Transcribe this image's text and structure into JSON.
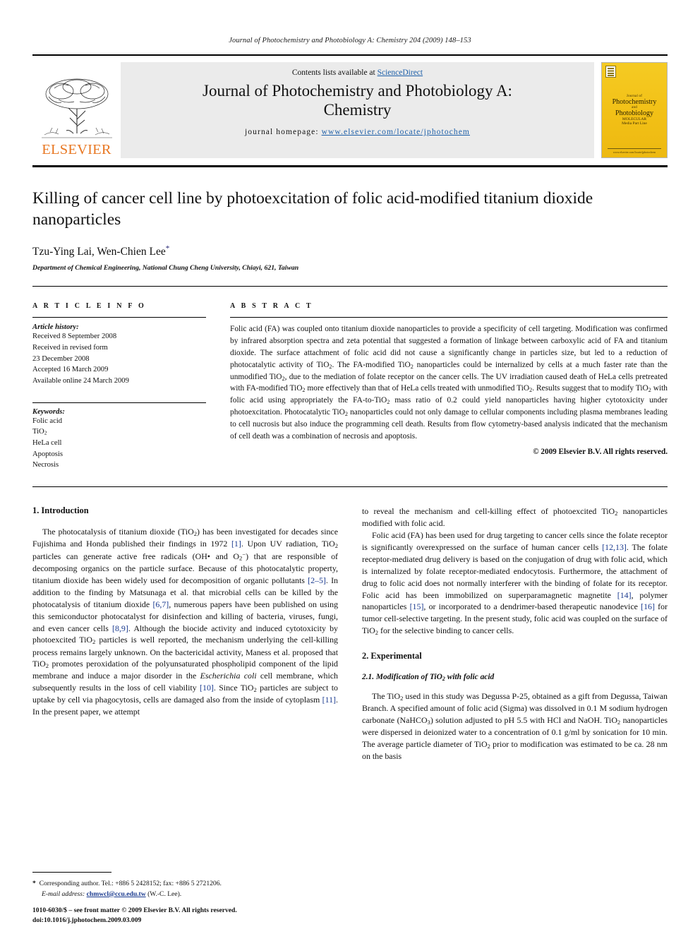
{
  "running_head": "Journal of Photochemistry and Photobiology A: Chemistry 204 (2009) 148–153",
  "masthead": {
    "publisher": "ELSEVIER",
    "contents_prefix": "Contents lists available at ",
    "contents_link": "ScienceDirect",
    "journal_title": "Journal of Photochemistry and Photobiology A: Chemistry",
    "homepage_prefix": "journal homepage: ",
    "homepage_url": "www.elsevier.com/locate/jphotochem",
    "cover": {
      "line_small": "Journal of",
      "line_big_1": "Photochemistry",
      "line_and": "and",
      "line_big_2": "Photobiology",
      "line_mid": "MOLECULAR",
      "line_foot": "Media Part Line",
      "bottom_note": "www.elsevier.com/locate/jphotochem"
    }
  },
  "title": "Killing of cancer cell line by photoexcitation of folic acid-modified titanium dioxide nanoparticles",
  "authors": "Tzu-Ying Lai, Wen-Chien Lee",
  "author_marker": "*",
  "affiliation": "Department of Chemical Engineering, National Chung Cheng University, Chiayi, 621, Taiwan",
  "article_info": {
    "heading": "A R T I C L E   I N F O",
    "history_label": "Article history:",
    "history": [
      "Received 8 September 2008",
      "Received in revised form",
      "23 December 2008",
      "Accepted 16 March 2009",
      "Available online 24 March 2009"
    ],
    "keywords_label": "Keywords:",
    "keywords": [
      "Folic acid",
      "TiO2",
      "HeLa cell",
      "Apoptosis",
      "Necrosis"
    ]
  },
  "abstract": {
    "heading": "A B S T R A C T",
    "text": "Folic acid (FA) was coupled onto titanium dioxide nanoparticles to provide a specificity of cell targeting. Modification was confirmed by infrared absorption spectra and zeta potential that suggested a formation of linkage between carboxylic acid of FA and titanium dioxide. The surface attachment of folic acid did not cause a significantly change in particles size, but led to a reduction of photocatalytic activity of TiO2. The FA-modified TiO2 nanoparticles could be internalized by cells at a much faster rate than the unmodified TiO2, due to the mediation of folate receptor on the cancer cells. The UV irradiation caused death of HeLa cells pretreated with FA-modified TiO2 more effectively than that of HeLa cells treated with unmodified TiO2. Results suggest that to modify TiO2 with folic acid using appropriately the FA-to-TiO2 mass ratio of 0.2 could yield nanoparticles having higher cytotoxicity under photoexcitation. Photocatalytic TiO2 nanoparticles could not only damage to cellular components including plasma membranes leading to cell nucrosis but also induce the programming cell death. Results from flow cytometry-based analysis indicated that the mechanism of cell death was a combination of necrosis and apoptosis.",
    "copyright": "© 2009 Elsevier B.V. All rights reserved."
  },
  "sections": {
    "intro_heading": "1.  Introduction",
    "intro_p1": "The photocatalysis of titanium dioxide (TiO2) has been investigated for decades since Fujishima and Honda published their findings in 1972 [1]. Upon UV radiation, TiO2 particles can generate active free radicals (OH• and O2−) that are responsible of decomposing organics on the particle surface. Because of this photocatalytic property, titanium dioxide has been widely used for decomposition of organic pollutants [2–5]. In addition to the finding by Matsunaga et al. that microbial cells can be killed by the photocatalysis of titanium dioxide [6,7], numerous papers have been published on using this semiconductor photocatalyst for disinfection and killing of bacteria, viruses, fungi, and even cancer cells [8,9]. Although the biocide activity and induced cytotoxicity by photoexcited TiO2 particles is well reported, the mechanism underlying the cell-killing process remains largely unknown. On the bactericidal activity, Maness et al. proposed that TiO2 promotes peroxidation of the polyunsaturated phospholipid component of the lipid membrane and induce a major disorder in the Escherichia coli cell membrane, which subsequently results in the loss of cell viability [10]. Since TiO2 particles are subject to uptake by cell via phagocytosis, cells are damaged also from the inside of cytoplasm [11]. In the present paper, we attempt to reveal the mechanism and cell-killing effect of photoexcited TiO2 nanoparticles modified with folic acid.",
    "intro_p2": "Folic acid (FA) has been used for drug targeting to cancer cells since the folate receptor is significantly overexpressed on the surface of human cancer cells [12,13]. The folate receptor-mediated drug delivery is based on the conjugation of drug with folic acid, which is internalized by folate receptor-mediated endocytosis. Furthermore, the attachment of drug to folic acid does not normally interferer with the binding of folate for its receptor. Folic acid has been immobilized on superparamagnetic magnetite [14], polymer nanoparticles [15], or incorporated to a dendrimer-based therapeutic nanodevice [16] for tumor cell-selective targeting. In the present study, folic acid was coupled on the surface of TiO2 for the selective binding to cancer cells.",
    "exp_heading": "2.  Experimental",
    "exp_sub_heading": "2.1.  Modification of TiO2 with folic acid",
    "exp_p1": "The TiO2 used in this study was Degussa P-25, obtained as a gift from Degussa, Taiwan Branch. A specified amount of folic acid (Sigma) was dissolved in 0.1 M sodium hydrogen carbonate (NaHCO3) solution adjusted to pH 5.5 with HCl and NaOH. TiO2 nanoparticles were dispersed in deionized water to a concentration of 0.1 g/ml by sonication for 10 min. The average particle diameter of TiO2 prior to modification was estimated to be ca. 28 nm on the basis"
  },
  "footnote": {
    "marker": "*",
    "corresponding": "Corresponding author. Tel.: +886 5 2428152; fax: +886 5 2721206.",
    "email_label": "E-mail address:",
    "email": "chmwcl@ccu.edu.tw",
    "email_suffix": "(W.-C. Lee)."
  },
  "imprint": {
    "line1": "1010-6030/$ – see front matter © 2009 Elsevier B.V. All rights reserved.",
    "line2": "doi:10.1016/j.jphotochem.2009.03.009"
  },
  "colors": {
    "link": "#1d5fa8",
    "reference": "#1a3a8f",
    "elsevier_orange": "#E87722",
    "cover_yellow": "#f3c41b",
    "band_gray": "#ebebeb"
  }
}
